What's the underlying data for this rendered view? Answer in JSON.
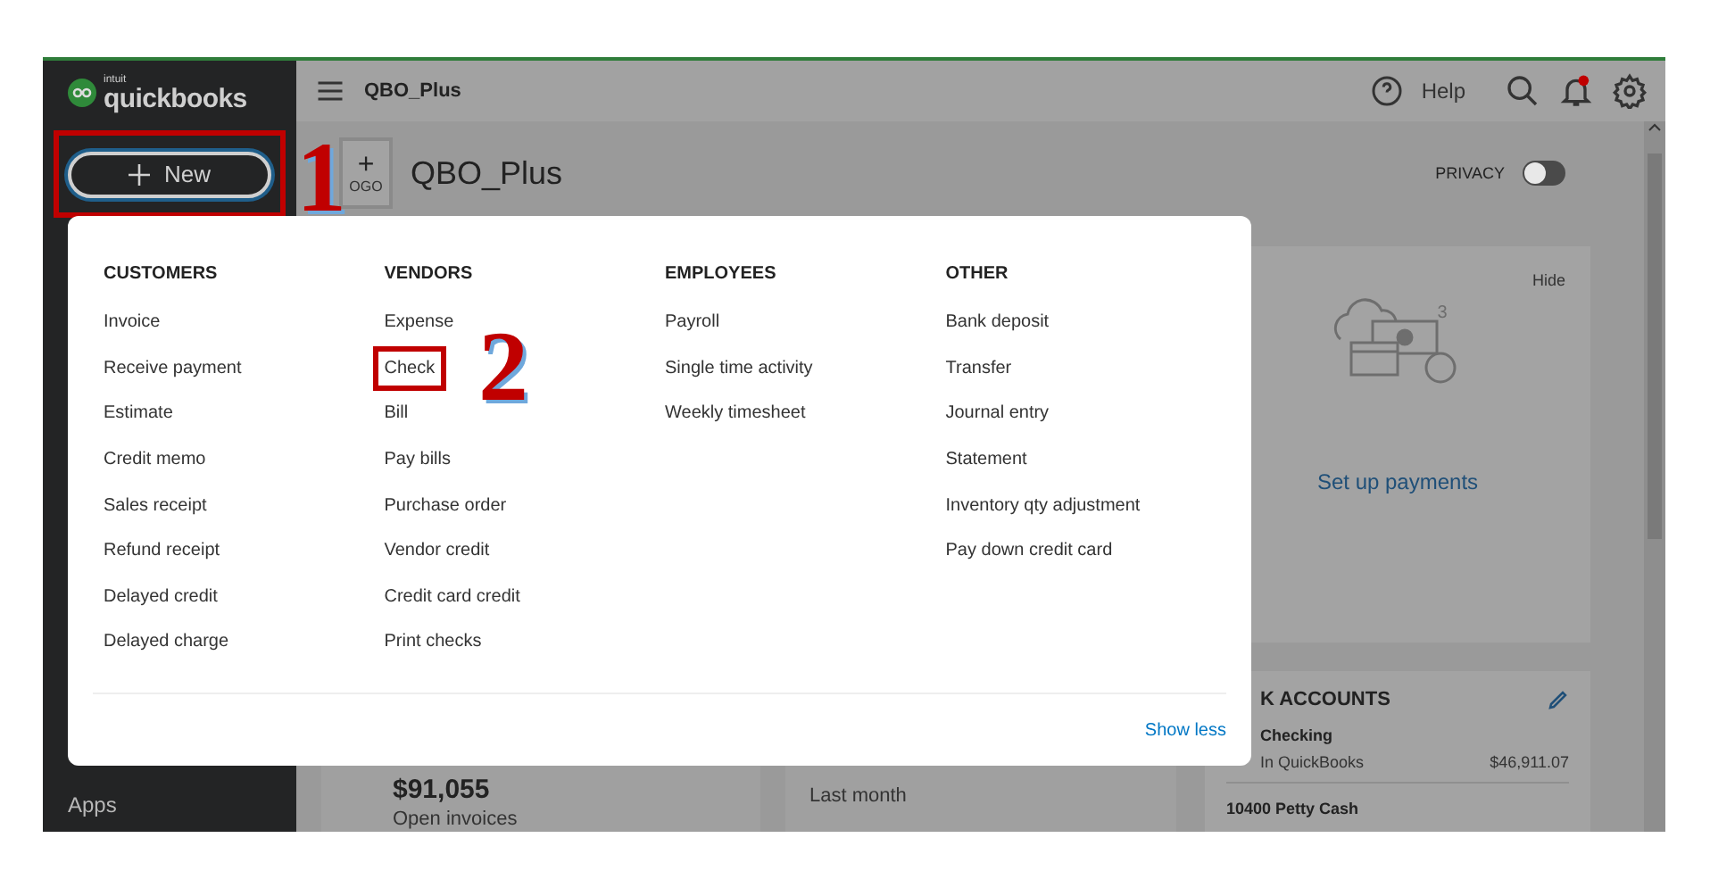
{
  "app": {
    "logo_small": "intuit",
    "logo": "quickbooks"
  },
  "sidebar": {
    "new_button": {
      "label": "New",
      "highlighted": true
    },
    "items": [
      {
        "label": "Apps"
      }
    ]
  },
  "topbar": {
    "company": "QBO_Plus",
    "help": "Help",
    "notifications": true
  },
  "company": {
    "logo_plus": "+",
    "logo_label": "OGO",
    "name": "QBO_Plus",
    "privacy": {
      "label": "PRIVACY",
      "on": false
    }
  },
  "new_menu": {
    "columns": [
      {
        "heading": "CUSTOMERS",
        "items": [
          {
            "label": "Invoice",
            "highlighted": false
          },
          {
            "label": "Receive payment",
            "highlighted": false
          },
          {
            "label": "Estimate",
            "highlighted": false
          },
          {
            "label": "Credit memo",
            "highlighted": false
          },
          {
            "label": "Sales receipt",
            "highlighted": false
          },
          {
            "label": "Refund receipt",
            "highlighted": false
          },
          {
            "label": "Delayed credit",
            "highlighted": false
          },
          {
            "label": "Delayed charge",
            "highlighted": false
          }
        ]
      },
      {
        "heading": "VENDORS",
        "items": [
          {
            "label": "Expense",
            "highlighted": false
          },
          {
            "label": "Check",
            "highlighted": true
          },
          {
            "label": "Bill",
            "highlighted": false
          },
          {
            "label": "Pay bills",
            "highlighted": false
          },
          {
            "label": "Purchase order",
            "highlighted": false
          },
          {
            "label": "Vendor credit",
            "highlighted": false
          },
          {
            "label": "Credit card credit",
            "highlighted": false
          },
          {
            "label": "Print checks",
            "highlighted": false
          }
        ]
      },
      {
        "heading": "EMPLOYEES",
        "items": [
          {
            "label": "Payroll",
            "highlighted": false
          },
          {
            "label": "Single time activity",
            "highlighted": false
          },
          {
            "label": "Weekly timesheet",
            "highlighted": false
          }
        ]
      },
      {
        "heading": "OTHER",
        "items": [
          {
            "label": "Bank deposit",
            "highlighted": false
          },
          {
            "label": "Transfer",
            "highlighted": false
          },
          {
            "label": "Journal entry",
            "highlighted": false
          },
          {
            "label": "Statement",
            "highlighted": false
          },
          {
            "label": "Inventory qty adjustment",
            "highlighted": false
          },
          {
            "label": "Pay down credit card",
            "highlighted": false
          }
        ]
      }
    ],
    "footer_link": "Show less"
  },
  "payments_card": {
    "hide": "Hide",
    "badge": "3",
    "link": "Set up payments"
  },
  "bank_accounts": {
    "title": "K ACCOUNTS",
    "accounts": [
      {
        "name": "Checking",
        "source": "In QuickBooks",
        "balance": "$46,911.07"
      },
      {
        "name": "10400 Petty Cash"
      }
    ]
  },
  "invoices_card": {
    "amount": "$91,055",
    "caption": "Open invoices"
  },
  "expenses_card": {
    "period": "Last month"
  },
  "annotations": [
    {
      "number": "1"
    },
    {
      "number": "2"
    }
  ]
}
